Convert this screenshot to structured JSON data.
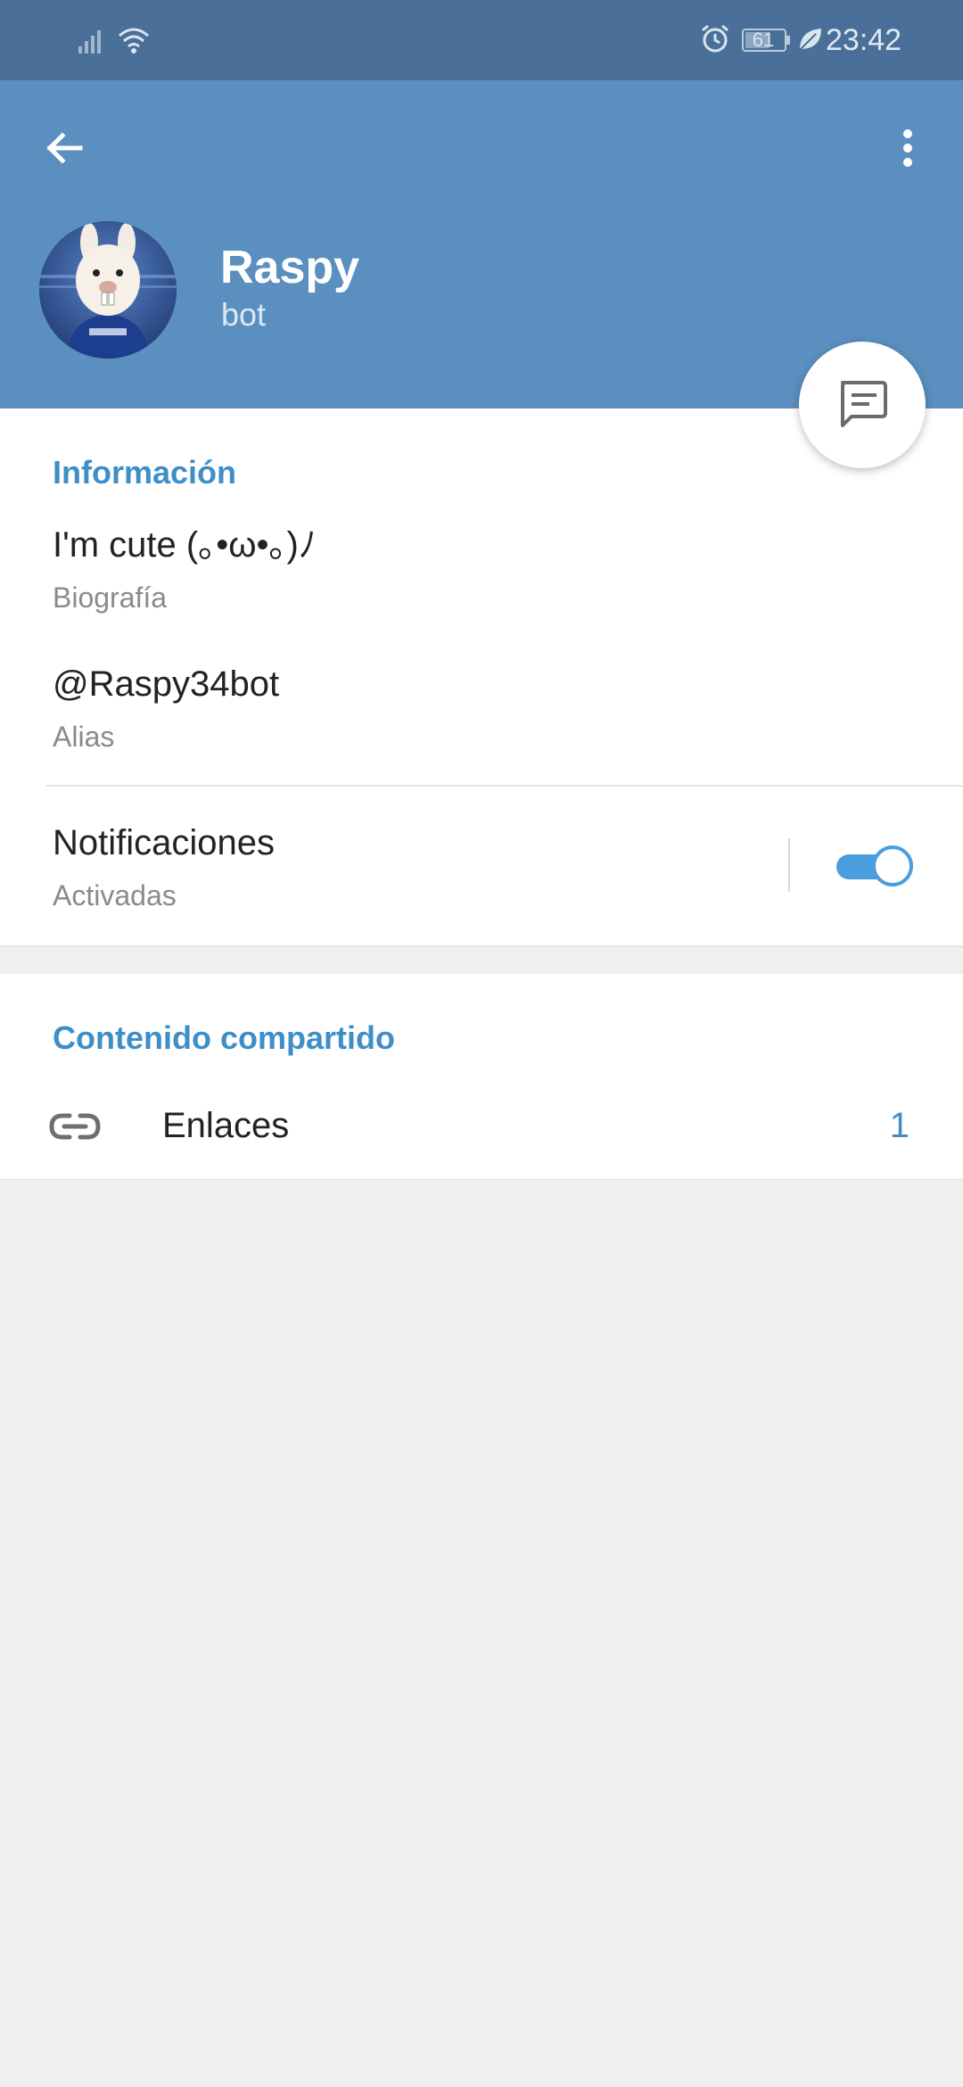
{
  "status_bar": {
    "battery": "61",
    "time": "23:42",
    "icons": [
      "signal-icon",
      "wifi-icon",
      "alarm-icon",
      "battery-icon",
      "leaf-icon"
    ]
  },
  "header": {
    "name": "Raspy",
    "status": "bot",
    "background_color": "#5b8fbf"
  },
  "info": {
    "title": "Información",
    "bio_value": "I'm cute (｡•ω•｡)ﾉ",
    "bio_label": "Biografía",
    "alias_value": "@Raspy34bot",
    "alias_label": "Alias",
    "notifications_value": "Notificaciones",
    "notifications_label": "Activadas",
    "notifications_on": true
  },
  "shared": {
    "title": "Contenido compartido",
    "links_label": "Enlaces",
    "links_count": "1"
  },
  "colors": {
    "accent": "#3e8ec8",
    "status_bar": "#4a7099",
    "toggle": "#4b9edd"
  }
}
